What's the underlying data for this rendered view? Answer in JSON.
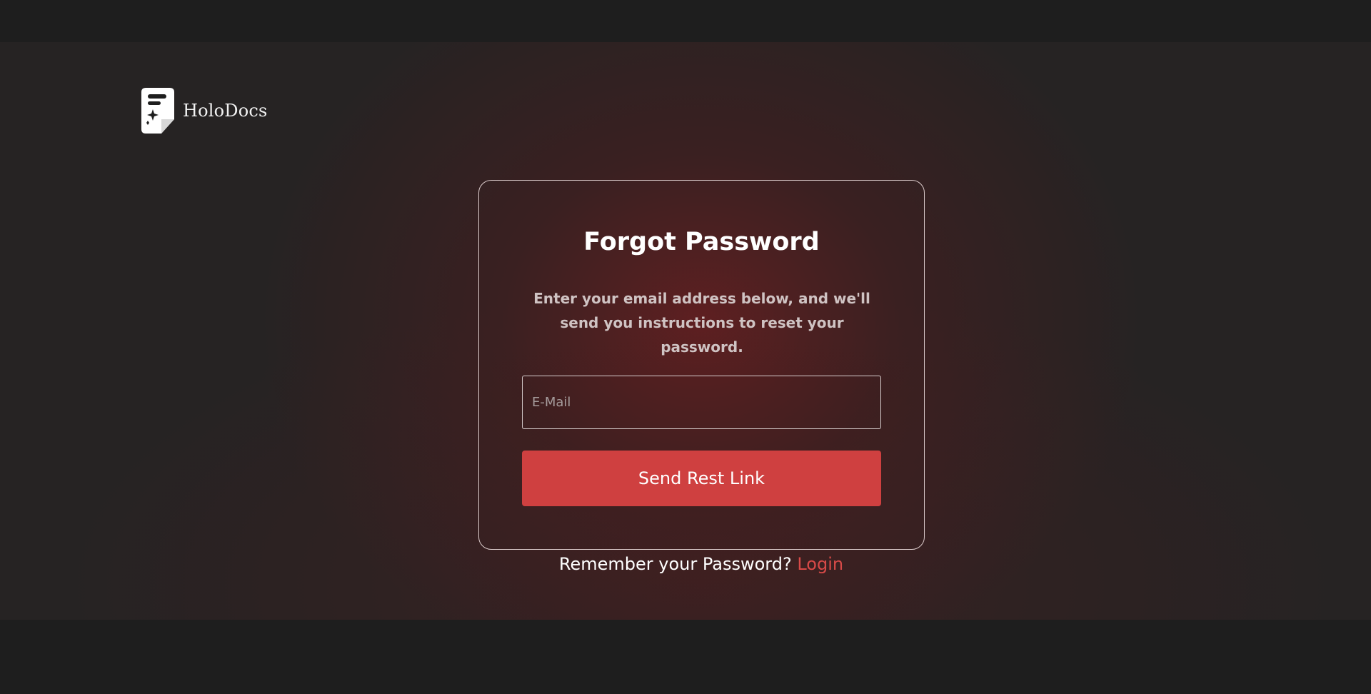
{
  "brand": {
    "name": "HoloDocs",
    "icon": "document-sparkle-icon"
  },
  "card": {
    "title": "Forgot Password",
    "description": "Enter your email address below, and we'll send you instructions to reset your password.",
    "email_placeholder": "E-Mail",
    "email_value": "",
    "submit_label": "Send Rest Link"
  },
  "footer": {
    "prompt": "Remember your Password?",
    "login_label": "Login"
  },
  "colors": {
    "page_background": "#1e1e1e",
    "accent": "#cf4040",
    "link": "#d94a48",
    "card_border": "#d9c9c9"
  }
}
